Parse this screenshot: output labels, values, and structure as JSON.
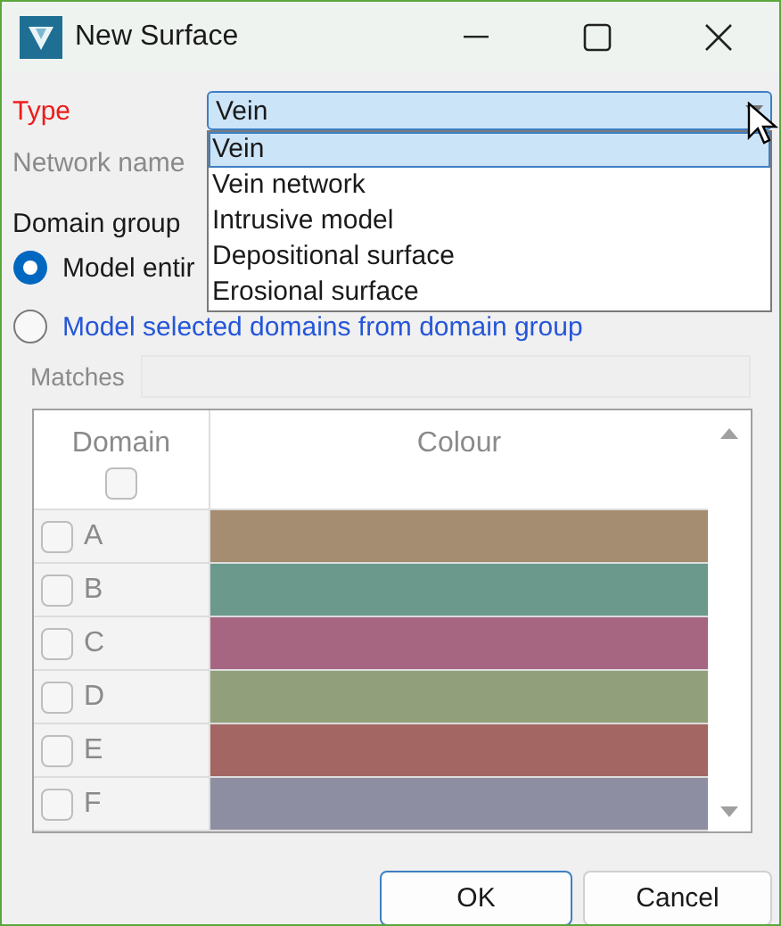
{
  "window": {
    "title": "New Surface"
  },
  "type_field": {
    "label": "Type",
    "invalid": true,
    "value": "Vein",
    "expanded": true,
    "options": [
      {
        "label": "Vein",
        "selected": true
      },
      {
        "label": "Vein network",
        "selected": false
      },
      {
        "label": "Intrusive model",
        "selected": false
      },
      {
        "label": "Depositional surface",
        "selected": false
      },
      {
        "label": "Erosional surface",
        "selected": false
      }
    ]
  },
  "network_name": {
    "label": "Network name",
    "disabled": true
  },
  "domain_group": {
    "label": "Domain group"
  },
  "radios": [
    {
      "label": "Model entir",
      "selected": true,
      "highlighted": false
    },
    {
      "label": "Model selected domains from domain group",
      "selected": false,
      "highlighted": true
    }
  ],
  "matches": {
    "label": "Matches",
    "disabled": true
  },
  "table": {
    "columns": [
      "Domain",
      "Colour"
    ],
    "header_checked": false,
    "rows": [
      {
        "name": "A",
        "checked": false,
        "color": "#a58d72"
      },
      {
        "name": "B",
        "checked": false,
        "color": "#6b998b"
      },
      {
        "name": "C",
        "checked": false,
        "color": "#a66682"
      },
      {
        "name": "D",
        "checked": false,
        "color": "#91a07b"
      },
      {
        "name": "E",
        "checked": false,
        "color": "#a46663"
      },
      {
        "name": "F",
        "checked": false,
        "color": "#8e8ea2"
      }
    ]
  },
  "buttons": [
    {
      "label": "OK",
      "default": true
    },
    {
      "label": "Cancel",
      "default": false
    }
  ]
}
